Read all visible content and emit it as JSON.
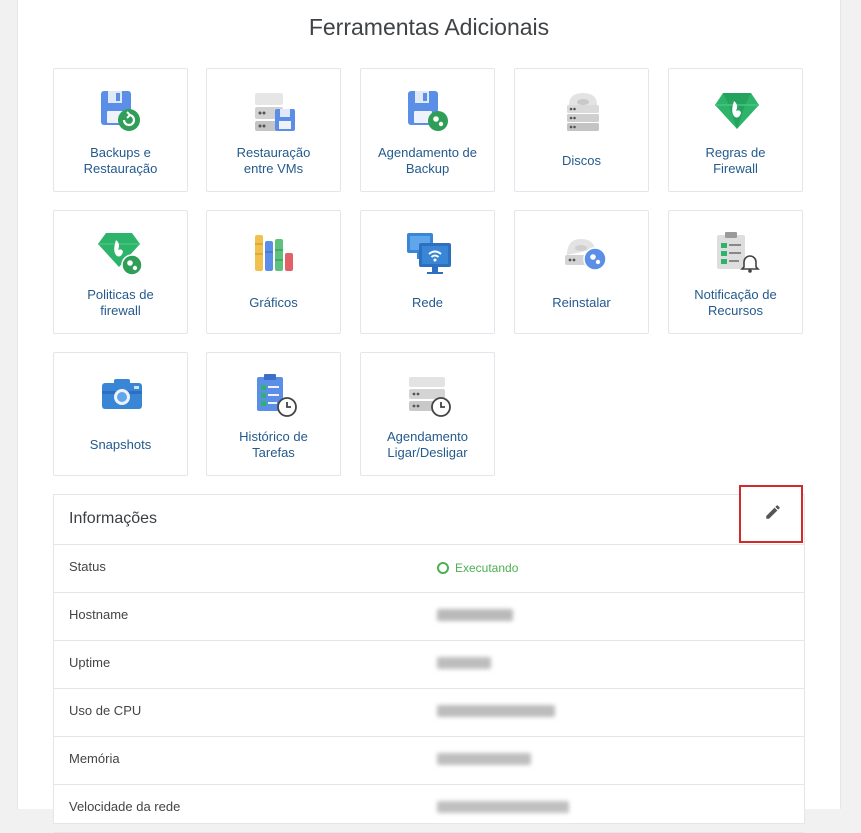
{
  "page": {
    "title": "Ferramentas Adicionais"
  },
  "tools": [
    {
      "line1": "Backups e",
      "line2": "Restauração",
      "icon": "backup-restore-icon"
    },
    {
      "line1": "Restauração",
      "line2": "entre VMs",
      "icon": "vm-restore-icon"
    },
    {
      "line1": "Agendamento de",
      "line2": "Backup",
      "icon": "backup-schedule-icon"
    },
    {
      "line1": "Discos",
      "line2": "",
      "icon": "disks-icon"
    },
    {
      "line1": "Regras de",
      "line2": "Firewall",
      "icon": "firewall-rules-icon"
    },
    {
      "line1": "Politicas de",
      "line2": "firewall",
      "icon": "firewall-policy-icon"
    },
    {
      "line1": "Gráficos",
      "line2": "",
      "icon": "charts-icon"
    },
    {
      "line1": "Rede",
      "line2": "",
      "icon": "network-icon"
    },
    {
      "line1": "Reinstalar",
      "line2": "",
      "icon": "reinstall-icon"
    },
    {
      "line1": "Notificação de",
      "line2": "Recursos",
      "icon": "resource-notification-icon"
    },
    {
      "line1": "Snapshots",
      "line2": "",
      "icon": "snapshot-icon"
    },
    {
      "line1": "Histórico de",
      "line2": "Tarefas",
      "icon": "task-history-icon"
    },
    {
      "line1": "Agendamento",
      "line2": "Ligar/Desligar",
      "icon": "power-schedule-icon"
    }
  ],
  "info": {
    "title": "Informações",
    "edit_icon": "pencil-icon",
    "rows": [
      {
        "label": "Status",
        "value": "Executando"
      },
      {
        "label": "Hostname"
      },
      {
        "label": "Uptime"
      },
      {
        "label": "Uso de CPU"
      },
      {
        "label": "Memória"
      },
      {
        "label": "Velocidade da rede"
      }
    ]
  },
  "colors": {
    "link": "#245a8d",
    "status_ok": "#4caf50",
    "highlight": "#d02a2a"
  }
}
